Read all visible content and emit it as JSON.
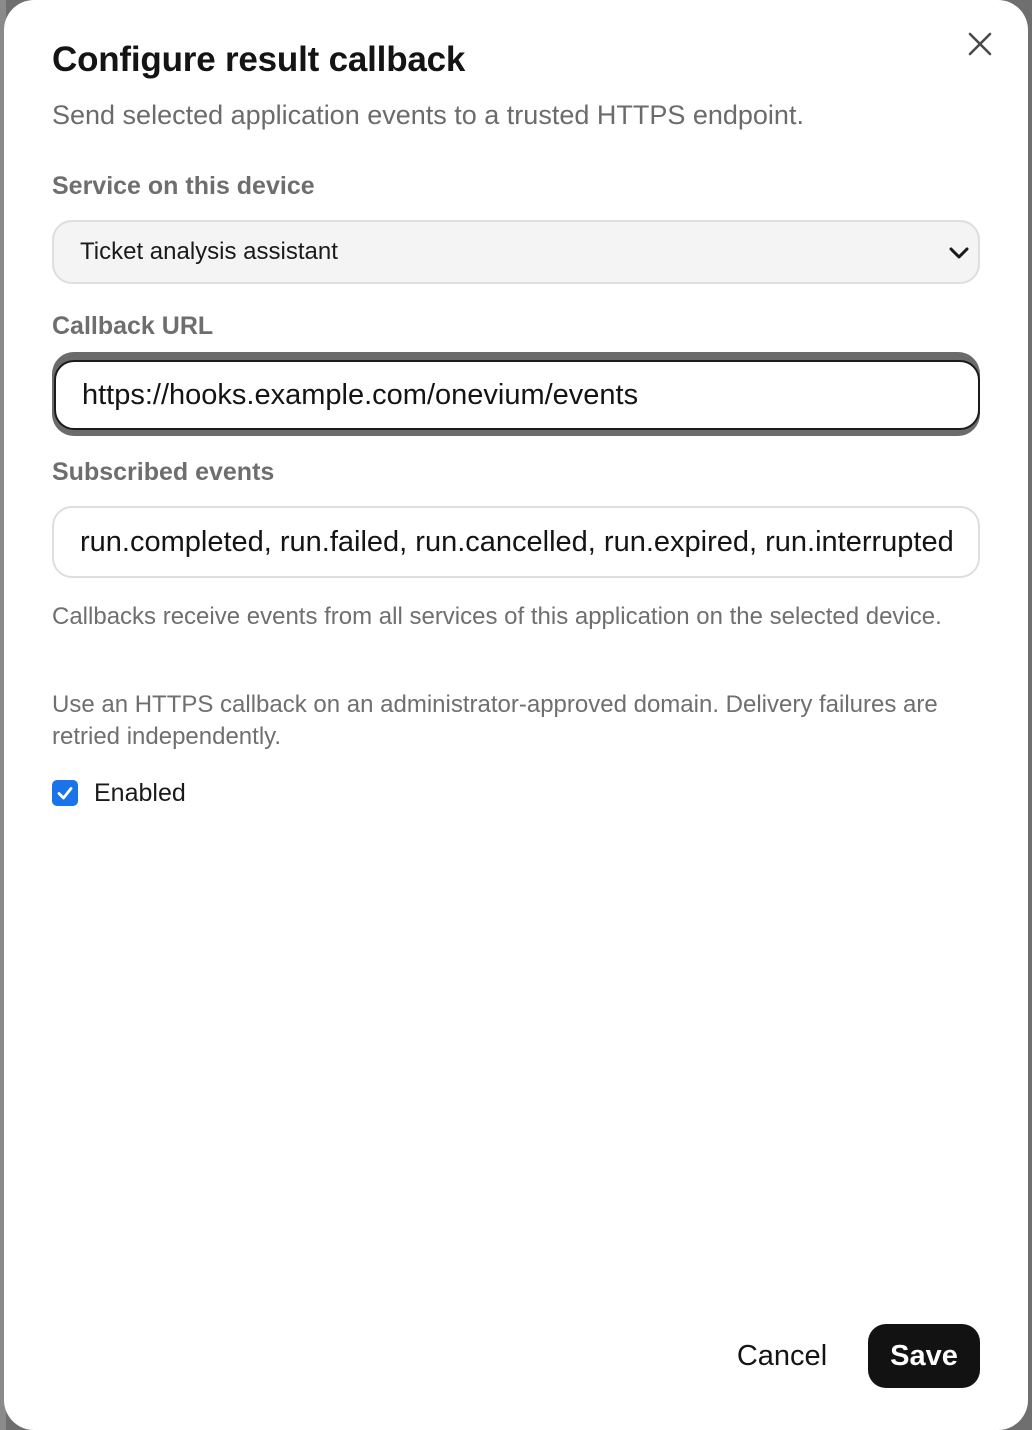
{
  "dialog": {
    "title": "Configure result callback",
    "subtitle": "Send selected application events to a trusted HTTPS endpoint.",
    "close_icon": "close-icon"
  },
  "service": {
    "label": "Service on this device",
    "selected": "Ticket analysis assistant"
  },
  "callback_url": {
    "label": "Callback URL",
    "value": "https://hooks.example.com/onevium/events"
  },
  "subscribed_events": {
    "label": "Subscribed events",
    "value": "run.completed, run.failed, run.cancelled, run.expired, run.interrupted"
  },
  "help": {
    "scope_note": "Callbacks receive events from all services of this application on the selected device.",
    "https_note": "Use an HTTPS callback on an administrator-approved domain. Delivery failures are retried independently."
  },
  "enabled": {
    "label": "Enabled",
    "checked": true
  },
  "actions": {
    "cancel_label": "Cancel",
    "save_label": "Save"
  },
  "colors": {
    "accent": "#1a73e8",
    "primary_button": "#121212"
  }
}
